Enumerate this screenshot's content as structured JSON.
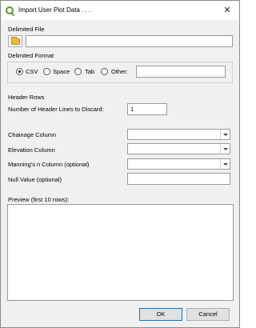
{
  "window": {
    "title": "Import User Plot Data . . .",
    "close_glyph": "✕",
    "app_icon": "qgis-icon"
  },
  "delimited_file": {
    "section_label": "Delimited File",
    "path_value": "",
    "browse_icon": "folder-icon"
  },
  "delimited_format": {
    "section_label": "Delimited Format",
    "options": [
      {
        "label": "CSV",
        "checked": true
      },
      {
        "label": "Space",
        "checked": false
      },
      {
        "label": "Tab",
        "checked": false
      },
      {
        "label": "Other:",
        "checked": false
      }
    ],
    "other_value": ""
  },
  "header_rows": {
    "section_label": "Header Rows",
    "discard_label": "Number of Header Lines to Discard:",
    "discard_value": "1"
  },
  "columns": {
    "chainage_label": "Chainage Column",
    "chainage_value": "",
    "elevation_label": "Elevation Column",
    "elevation_value": "",
    "mannings_label": "Manning's n Column (optional)",
    "mannings_value": "",
    "null_label": "Null Value (optional)",
    "null_value": ""
  },
  "preview": {
    "label": "Preview (first 10 rows):"
  },
  "buttons": {
    "ok": "OK",
    "cancel": "Cancel"
  }
}
